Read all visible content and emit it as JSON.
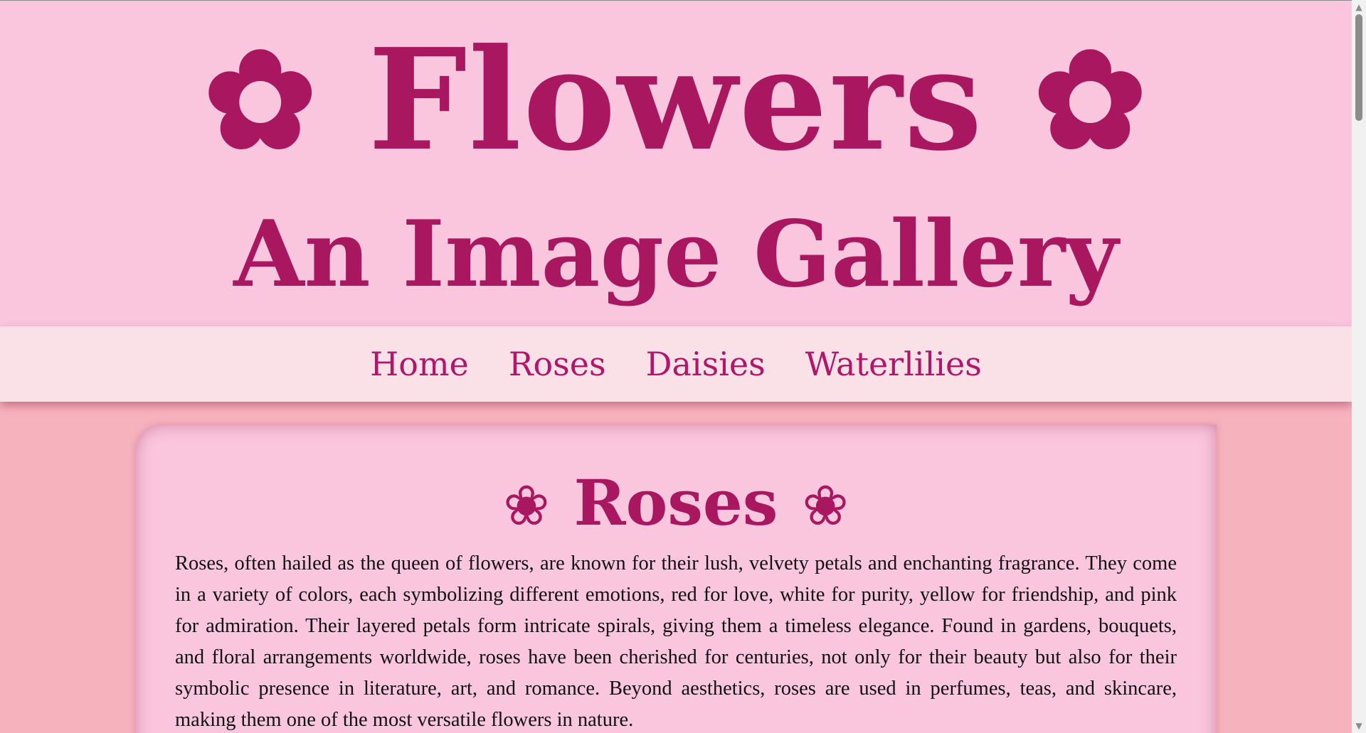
{
  "header": {
    "flower_icon": "✿",
    "title": "Flowers",
    "subtitle": "An Image Gallery"
  },
  "nav": {
    "items": [
      {
        "label": "Home"
      },
      {
        "label": "Roses"
      },
      {
        "label": "Daisies"
      },
      {
        "label": "Waterlilies"
      }
    ]
  },
  "section": {
    "heading_icon": "❀",
    "heading": "Roses",
    "text": "Roses, often hailed as the queen of flowers, are known for their lush, velvety petals and enchanting fragrance. They come in a variety of colors, each symbolizing different emotions, red for love, white for purity, yellow for friendship, and pink for admiration. Their layered petals form intricate spirals, giving them a timeless elegance. Found in gardens, bouquets, and floral arrangements worldwide, roses have been cherished for centuries, not only for their beauty but also for their symbolic presence in literature, art, and romance. Beyond aesthetics, roses are used in perfumes, teas, and skincare, making them one of the most versatile flowers in nature."
  },
  "scrollbar": {
    "up_arrow": "▲",
    "down_arrow": "▼"
  },
  "colors": {
    "accent": "#a8175f",
    "nav_link": "#b0176a",
    "header_bg": "#fac6dd",
    "nav_bg": "#fae1e8",
    "page_bg": "#f7b3bd"
  }
}
